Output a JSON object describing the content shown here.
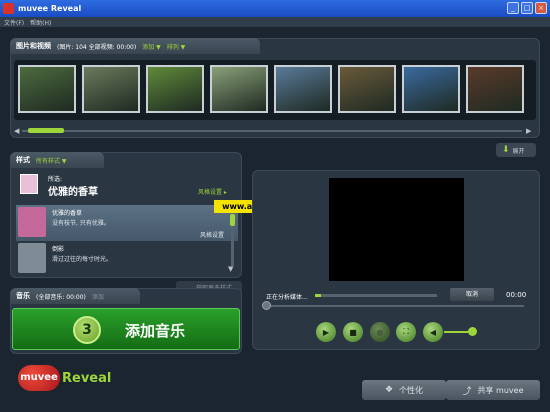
{
  "window": {
    "title": "muvee Reveal",
    "buttons": [
      "_",
      "□",
      "×"
    ]
  },
  "menu": [
    "文件(F)",
    "帮助(H)"
  ],
  "media": {
    "header_title": "图片和视频",
    "header_info": "(图片: 104 全部视频: 00:00)",
    "add_label": "添加 ▼",
    "sort_label": "排列 ▼",
    "thumbnails": [
      {
        "color": "#4d6b3e"
      },
      {
        "color": "#6b7a5c"
      },
      {
        "color": "#5f8a3a"
      },
      {
        "color": "#8aa078"
      },
      {
        "color": "#5a7a9a"
      },
      {
        "color": "#6a5a3a"
      },
      {
        "color": "#3a6aa0"
      },
      {
        "color": "#5a3a2a"
      }
    ],
    "expand_label": "展开"
  },
  "styles": {
    "header_title": "样式",
    "filter_label": "所有样式 ▼",
    "selected_prefix": "所选:",
    "selected_name": "优雅的香草",
    "style_settings_label": "风格设置 ▸",
    "items": [
      {
        "name": "优雅的香草",
        "desc": "没有枝节, 只有优雅。",
        "settings": "风格设置",
        "color": "#c46a9a"
      },
      {
        "name": "倒影",
        "desc": "滑过过往的每寸时光。",
        "settings": "",
        "color": "#7f8c96"
      }
    ],
    "more_label": "获取更多样式"
  },
  "watermark": "www.ankty.com 统一下载",
  "music": {
    "header_title": "音乐",
    "header_info": "(全部音乐: 00:00)",
    "add_label": "添加",
    "step_number": "3",
    "add_music_label": "添加音乐"
  },
  "player": {
    "status_label": "正在分析媒体...",
    "cancel_label": "取消",
    "time": "00:00",
    "controls": [
      "play",
      "stop",
      "save",
      "fullscreen",
      "volume"
    ],
    "progress": 0.05
  },
  "brand": {
    "logo": "muvee Reveal"
  },
  "footer": {
    "personalize_label": "个性化",
    "share_label": "共享 muvee"
  }
}
